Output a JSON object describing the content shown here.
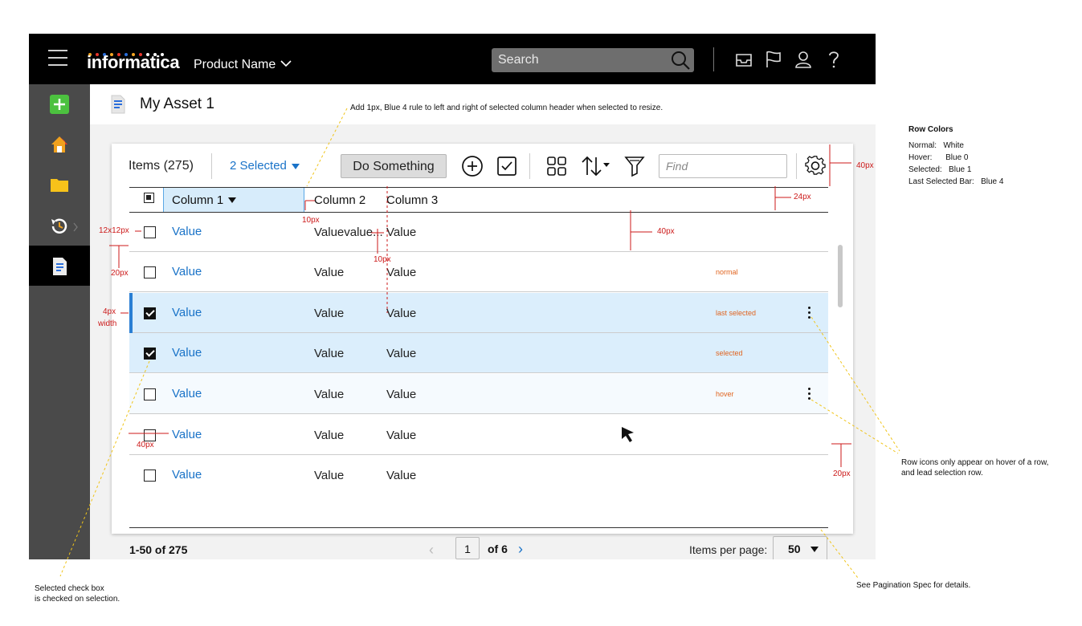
{
  "topbar": {
    "logo_text": "informatica",
    "product_name": "Product Name",
    "search_placeholder": "Search"
  },
  "asset": {
    "title": "My Asset 1"
  },
  "toolbar": {
    "items_count": "Items (275)",
    "selected_label": "2 Selected",
    "action_label": "Do Something",
    "find_placeholder": "Find"
  },
  "grid": {
    "columns": [
      "Column 1",
      "Column 2",
      "Column 3"
    ],
    "rows": [
      {
        "c1": "Value",
        "c2": "Valuevalue...",
        "c3": "Value",
        "checked": false,
        "label": ""
      },
      {
        "c1": "Value",
        "c2": "Value",
        "c3": "Value",
        "checked": false,
        "label": "normal"
      },
      {
        "c1": "Value",
        "c2": "Value",
        "c3": "Value",
        "checked": true,
        "label": "last selected"
      },
      {
        "c1": "Value",
        "c2": "Value",
        "c3": "Value",
        "checked": true,
        "label": "selected"
      },
      {
        "c1": "Value",
        "c2": "Value",
        "c3": "Value",
        "checked": false,
        "label": "hover"
      },
      {
        "c1": "Value",
        "c2": "Value",
        "c3": "Value",
        "checked": false,
        "label": ""
      },
      {
        "c1": "Value",
        "c2": "Value",
        "c3": "Value",
        "checked": false,
        "label": ""
      }
    ]
  },
  "pagination": {
    "range": "1-50 of 275",
    "page": "1",
    "of_pages": "of 6",
    "items_per_page_label": "Items per page:",
    "items_per_page": "50"
  },
  "annotations": {
    "column_resize": "Add 1px, Blue 4 rule to left and right of selected column header when selected to resize.",
    "m_40px_toolbar": "40px",
    "m_24px": "24px",
    "m_10px_a": "10px",
    "m_10px_b": "10px",
    "m_40px_row": "40px",
    "m_12x12": "12x12px",
    "m_20px_a": "20px",
    "m_4px": "4px",
    "m_width": "width",
    "m_40px_cb": "40px",
    "m_20px_b": "20px",
    "row_colors_title": "Row Colors",
    "row_colors": [
      {
        "k": "Normal:",
        "v": "White"
      },
      {
        "k": "Hover:",
        "v": "Blue 0"
      },
      {
        "k": "Selected:",
        "v": "Blue 1"
      },
      {
        "k": "Last Selected Bar:",
        "v": "Blue 4"
      }
    ],
    "row_icons_note_1": "Row icons only appear on hover of a row,",
    "row_icons_note_2": "and lead selection row.",
    "checkbox_note_1": "Selected check box",
    "checkbox_note_2": "is checked on selection.",
    "pagination_note": "See Pagination Spec for details."
  },
  "colors": {
    "accent": "#1a73c8",
    "selected_row": "#dbeefc",
    "hover_row": "#f5fafe",
    "last_selected_bar": "#2a7fd4",
    "annotation": "#cc1a1a",
    "state_label": "#e0641f"
  },
  "icons": [
    "menu-icon",
    "logo-dots",
    "chevron-down-icon",
    "search-icon",
    "inbox-icon",
    "flag-icon",
    "user-icon",
    "help-icon",
    "add-icon",
    "home-icon",
    "folder-icon",
    "recent-icon",
    "document-icon",
    "add-circle-icon",
    "check-square-icon",
    "grid-view-icon",
    "sort-icon",
    "filter-icon",
    "gear-icon",
    "kebab-icon",
    "cursor-icon"
  ]
}
